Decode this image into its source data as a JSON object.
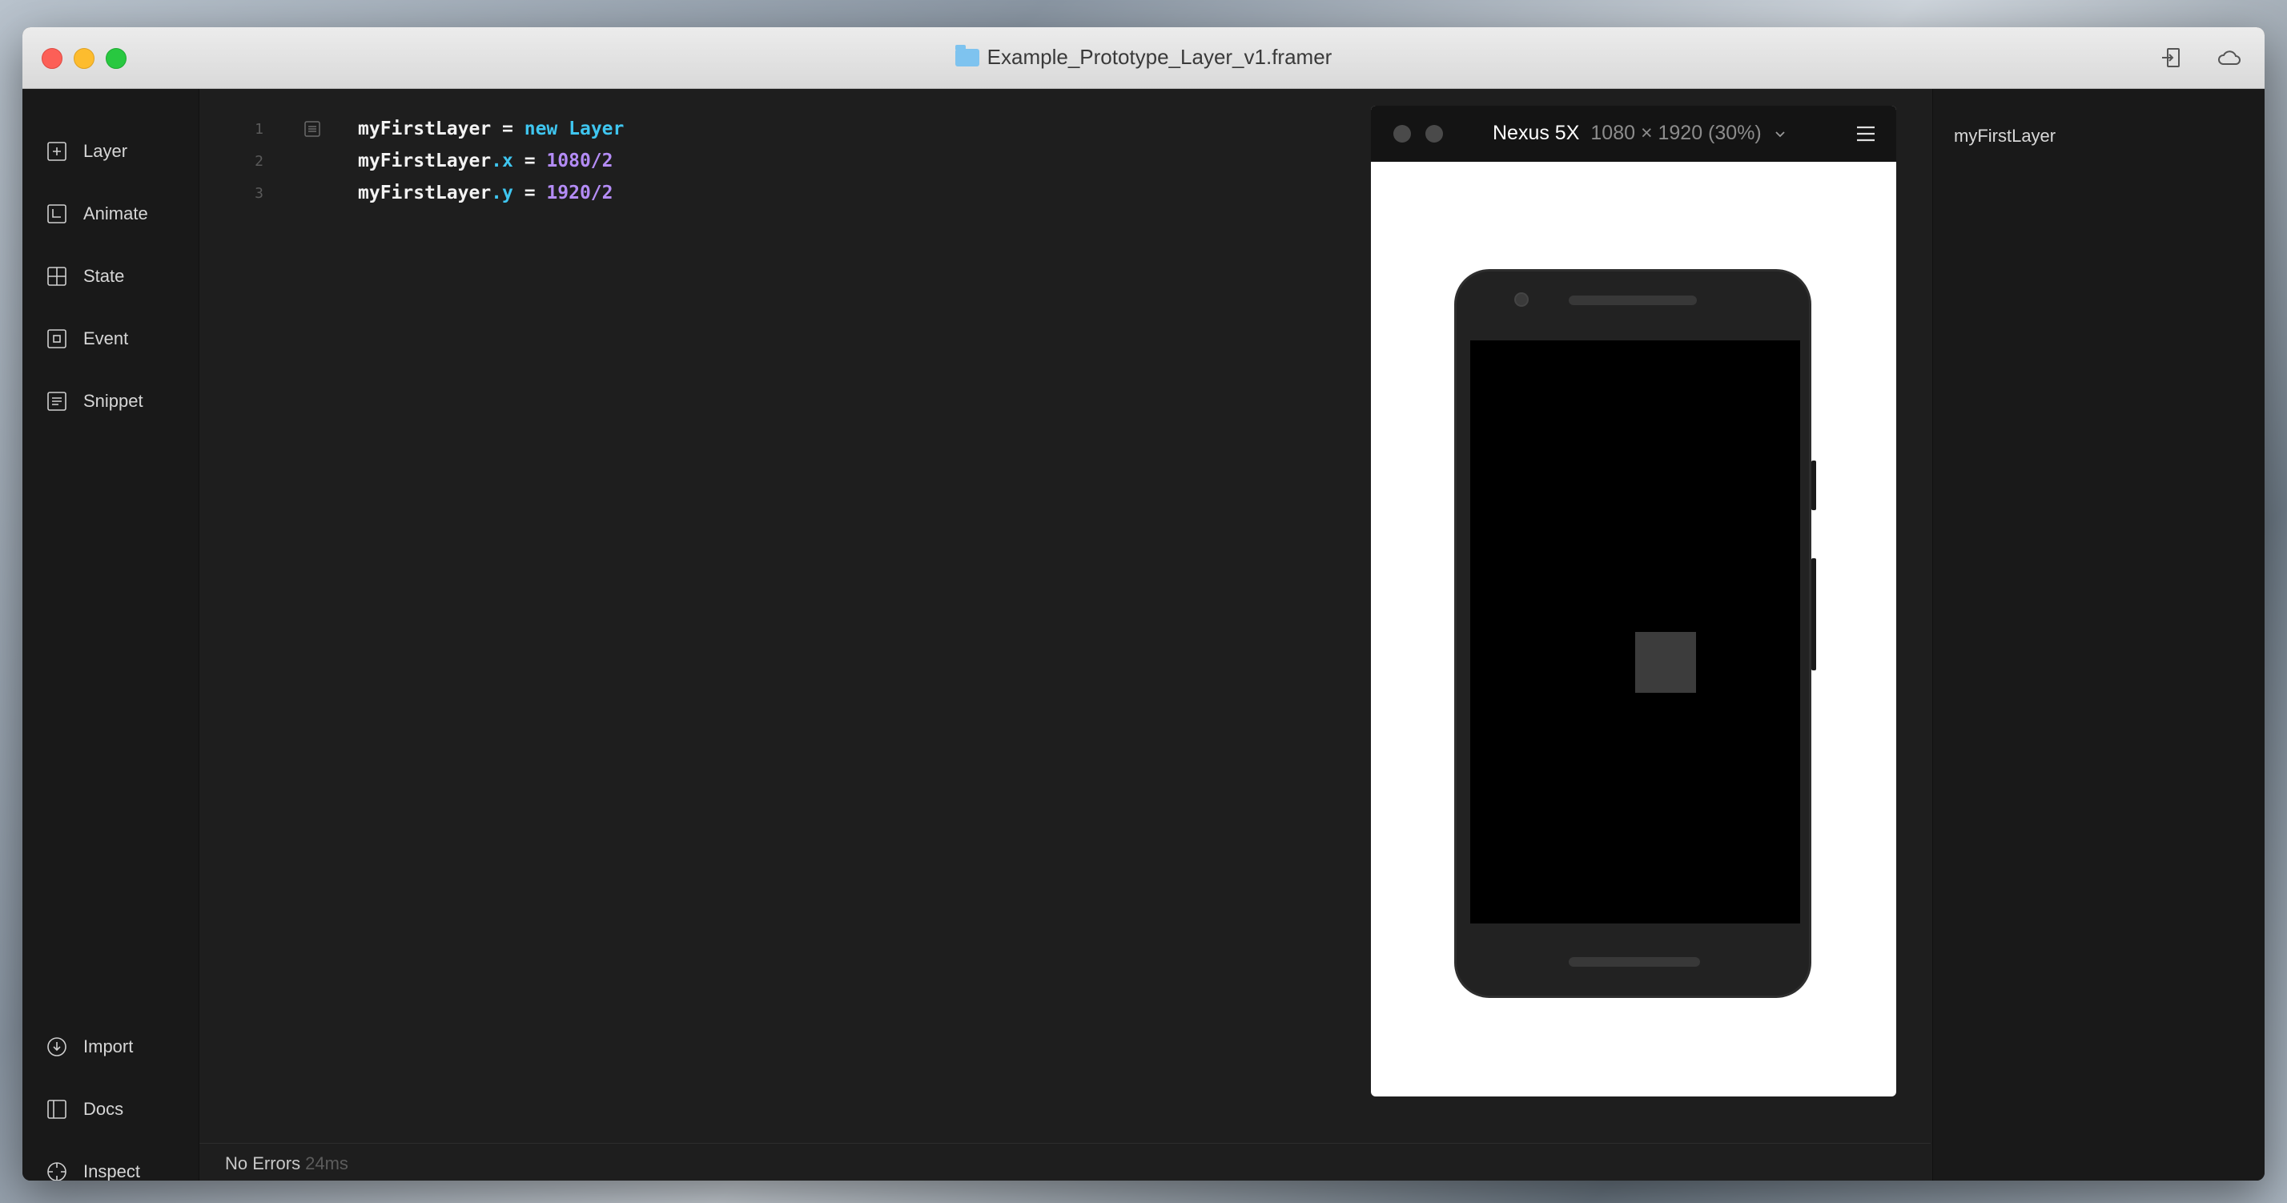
{
  "window": {
    "title": "Example_Prototype_Layer_v1.framer"
  },
  "sidebar": {
    "top_items": [
      {
        "label": "Layer",
        "icon": "plus-square-icon"
      },
      {
        "label": "Animate",
        "icon": "animate-square-icon"
      },
      {
        "label": "State",
        "icon": "grid-square-icon"
      },
      {
        "label": "Event",
        "icon": "target-square-icon"
      },
      {
        "label": "Snippet",
        "icon": "lines-square-icon"
      }
    ],
    "bottom_items": [
      {
        "label": "Import",
        "icon": "import-circle-icon"
      },
      {
        "label": "Docs",
        "icon": "docs-icon"
      },
      {
        "label": "Inspect",
        "icon": "crosshair-icon"
      }
    ]
  },
  "editor": {
    "lines": [
      {
        "number": "1",
        "tokens": {
          "var": "myFirstLayer",
          "op": " = ",
          "kw": "new",
          "cls": "Layer"
        }
      },
      {
        "number": "2",
        "tokens": {
          "var": "myFirstLayer",
          "prop": ".x",
          "op": " = ",
          "val": "1080/2"
        }
      },
      {
        "number": "3",
        "tokens": {
          "var": "myFirstLayer",
          "prop": ".y",
          "op": " = ",
          "val": "1920/2"
        }
      }
    ]
  },
  "status": {
    "text": "No Errors",
    "timing": "24ms"
  },
  "preview": {
    "device": "Nexus 5X",
    "resolution": "1080 × 1920 (30%)"
  },
  "layers": {
    "items": [
      "myFirstLayer"
    ]
  },
  "colors": {
    "keyword": "#3fc6f0",
    "number": "#b48cf6",
    "editor_bg": "#1e1e1e",
    "sidebar_bg": "#191919"
  }
}
